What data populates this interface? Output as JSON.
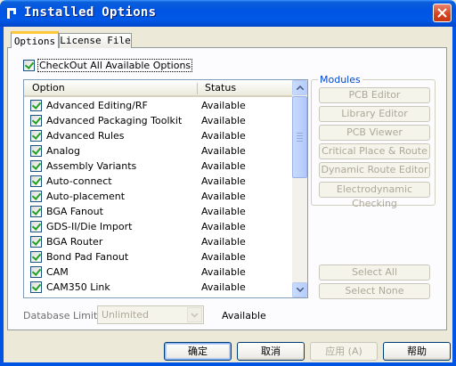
{
  "window": {
    "title": "Installed Options"
  },
  "tabs": [
    {
      "label": "Options",
      "active": true
    },
    {
      "label": "License File",
      "active": false
    }
  ],
  "checkout_all": {
    "label": "CheckOut All Available Options",
    "checked": true
  },
  "list": {
    "columns": [
      "Option",
      "Status"
    ],
    "rows": [
      {
        "option": "Advanced Editing/RF",
        "status": "Available",
        "checked": true
      },
      {
        "option": "Advanced Packaging Toolkit",
        "status": "Available",
        "checked": true
      },
      {
        "option": "Advanced Rules",
        "status": "Available",
        "checked": true
      },
      {
        "option": "Analog",
        "status": "Available",
        "checked": true
      },
      {
        "option": "Assembly Variants",
        "status": "Available",
        "checked": true
      },
      {
        "option": "Auto-connect",
        "status": "Available",
        "checked": true
      },
      {
        "option": "Auto-placement",
        "status": "Available",
        "checked": true
      },
      {
        "option": "BGA Fanout",
        "status": "Available",
        "checked": true
      },
      {
        "option": "GDS-II/Die Import",
        "status": "Available",
        "checked": true
      },
      {
        "option": "BGA Router",
        "status": "Available",
        "checked": true
      },
      {
        "option": "Bond Pad Fanout",
        "status": "Available",
        "checked": true
      },
      {
        "option": "CAM",
        "status": "Available",
        "checked": true
      },
      {
        "option": "CAM350 Link",
        "status": "Available",
        "checked": true
      }
    ]
  },
  "modules": {
    "title": "Modules",
    "buttons": [
      "PCB Editor",
      "Library Editor",
      "PCB Viewer",
      "Critical Place & Route",
      "Dynamic Route Editor",
      "Electrodynamic Checking"
    ],
    "select_all": "Select All",
    "select_none": "Select None"
  },
  "database_limit": {
    "label": "Database Limit:",
    "value": "Unlimited",
    "status": "Available"
  },
  "buttons": {
    "ok": "确定",
    "cancel": "取消",
    "apply": "应用 (A)",
    "help": "帮助"
  },
  "colors": {
    "title_bar": "#0054e3",
    "dialog_bg": "#ece9d8",
    "group_title": "#0046d5",
    "check": "#21a121"
  }
}
